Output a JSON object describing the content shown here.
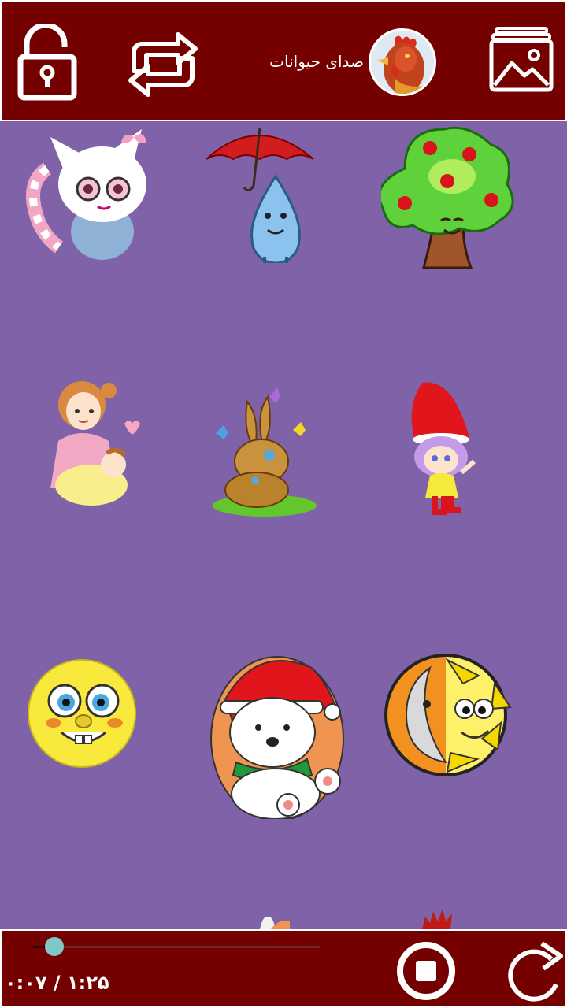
{
  "header": {
    "title": "صدای حیوانات",
    "lock_icon": "lock-open-icon",
    "repeat_icon": "repeat-icon",
    "gallery_icon": "gallery-icon",
    "avatar_icon": "rooster-avatar"
  },
  "grid": {
    "items": [
      {
        "name": "kitten-sticker"
      },
      {
        "name": "raindrop-umbrella-sticker"
      },
      {
        "name": "apple-tree-sticker"
      },
      {
        "name": "mother-baby-sticker"
      },
      {
        "name": "bunnies-butterflies-sticker"
      },
      {
        "name": "gnome-girl-sticker"
      },
      {
        "name": "sponge-face-sticker"
      },
      {
        "name": "polar-bear-santa-sticker"
      },
      {
        "name": "sun-moon-sticker"
      }
    ]
  },
  "player": {
    "time_display": "۰:۰۷ / ۱:۲۵",
    "progress": 0.08,
    "stop_icon": "stop-icon",
    "refresh_icon": "refresh-icon"
  },
  "colors": {
    "bar_background": "#750000",
    "page_background": "#8062a8",
    "seek_thumb": "#7ec8c8"
  }
}
